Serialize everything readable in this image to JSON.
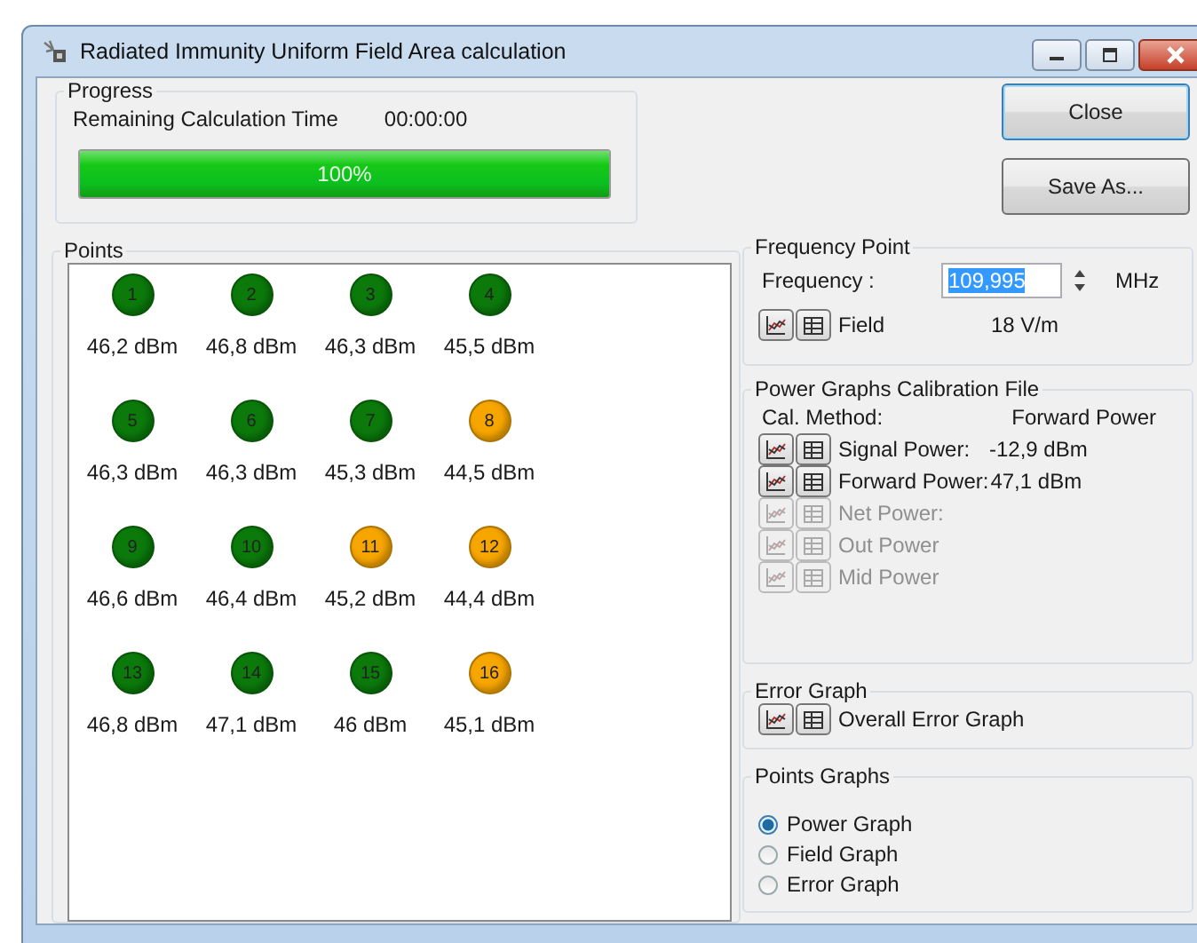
{
  "window": {
    "title": "Radiated Immunity Uniform Field Area calculation"
  },
  "progress": {
    "title": "Progress",
    "label": "Remaining Calculation Time",
    "time": "00:00:00",
    "level": 1,
    "percent": "100%"
  },
  "buttons": [
    {
      "label": "Close",
      "default": true
    },
    {
      "label": "Save As...",
      "default": false
    }
  ],
  "points": {
    "title": "Points",
    "items": [
      {
        "number": "1",
        "reading": "46,2 dBm",
        "color": "#0b7a0b"
      },
      {
        "number": "2",
        "reading": "46,8 dBm",
        "color": "#0b7a0b"
      },
      {
        "number": "3",
        "reading": "46,3 dBm",
        "color": "#0b7a0b"
      },
      {
        "number": "4",
        "reading": "45,5 dBm",
        "color": "#0b7a0b"
      },
      {
        "number": "5",
        "reading": "46,3 dBm",
        "color": "#0b7a0b"
      },
      {
        "number": "6",
        "reading": "46,3 dBm",
        "color": "#0b7a0b"
      },
      {
        "number": "7",
        "reading": "45,3 dBm",
        "color": "#0b7a0b"
      },
      {
        "number": "8",
        "reading": "44,5 dBm",
        "color": "#f7a600"
      },
      {
        "number": "9",
        "reading": "46,6 dBm",
        "color": "#0b7a0b"
      },
      {
        "number": "10",
        "reading": "46,4 dBm",
        "color": "#0b7a0b"
      },
      {
        "number": "11",
        "reading": "45,2 dBm",
        "color": "#f7a600"
      },
      {
        "number": "12",
        "reading": "44,4 dBm",
        "color": "#f7a600"
      },
      {
        "number": "13",
        "reading": "46,8 dBm",
        "color": "#0b7a0b"
      },
      {
        "number": "14",
        "reading": "47,1 dBm",
        "color": "#0b7a0b"
      },
      {
        "number": "15",
        "reading": "46 dBm",
        "color": "#0b7a0b"
      },
      {
        "number": "16",
        "reading": "45,1 dBm",
        "color": "#f7a600"
      }
    ]
  },
  "frequency_point": {
    "title": "Frequency Point",
    "frequency_label": "Frequency :",
    "frequency": "109,995",
    "text_selected": true,
    "unit": "MHz",
    "field_label": "Field",
    "field_value": "18 V/m"
  },
  "calibration": {
    "title": "Power Graphs Calibration File",
    "method_label": "Cal. Method:",
    "method": "Forward Power",
    "rows": [
      {
        "label": "Signal Power:",
        "value": "-12,9 dBm",
        "disabled": false
      },
      {
        "label": "Forward Power:",
        "value": "47,1 dBm",
        "disabled": false
      },
      {
        "label": "Net Power:",
        "disabled": true
      },
      {
        "label": "Out Power",
        "disabled": true
      },
      {
        "label": "Mid Power",
        "disabled": true
      }
    ]
  },
  "error_graph": {
    "title": "Error Graph",
    "label": "Overall Error Graph"
  },
  "points_graphs": {
    "title": "Points Graphs",
    "options": [
      {
        "label": "Power Graph",
        "selected": true
      },
      {
        "label": "Field Graph",
        "selected": false
      },
      {
        "label": "Error Graph",
        "selected": false
      }
    ]
  }
}
